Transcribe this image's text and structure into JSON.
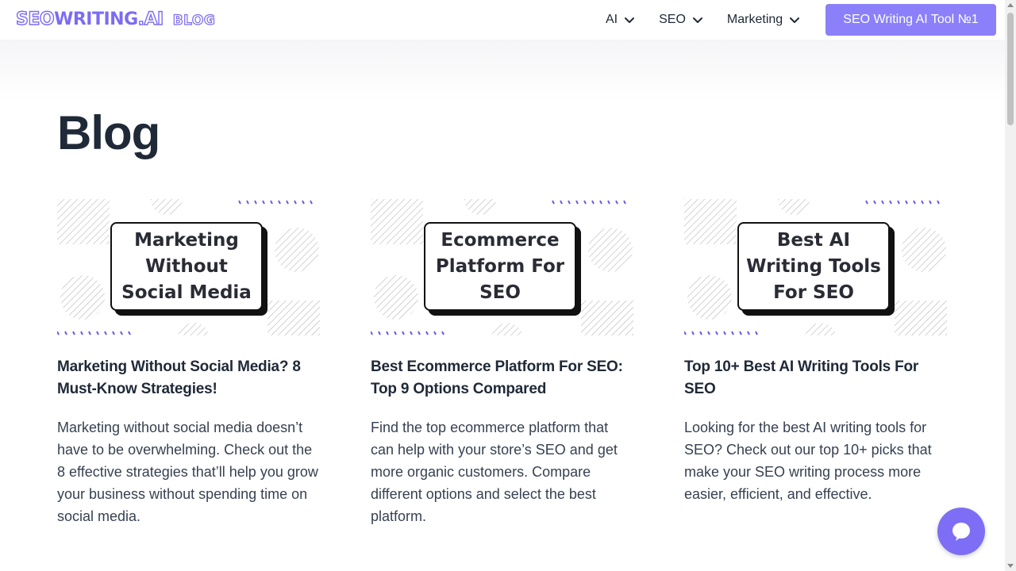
{
  "header": {
    "logo_seo": "SEO",
    "logo_writing": "WRITING",
    "logo_dot_ai": ".AI",
    "logo_blog": "BLOG",
    "nav": [
      {
        "label": "AI"
      },
      {
        "label": "SEO"
      },
      {
        "label": "Marketing"
      }
    ],
    "cta_label": "SEO Writing AI Tool №1"
  },
  "page": {
    "title": "Blog"
  },
  "cards": [
    {
      "thumb_text": "Marketing\nWithout\nSocial Media",
      "title": "Marketing Without Social Media? 8 Must-Know Strategies!",
      "description": "Marketing without social media doesn’t have to be overwhelming. Check out the 8 effective strategies that’ll help you grow your business without spending time on social media."
    },
    {
      "thumb_text": "Ecommerce\nPlatform For\nSEO",
      "title": "Best Ecommerce Platform For SEO: Top 9 Options Compared",
      "description": "Find the top ecommerce platform that can help with your store’s SEO and get more organic customers. Compare different options and select the best platform."
    },
    {
      "thumb_text": "Best AI\nWriting Tools\nFor SEO",
      "title": "Top 10+ Best AI Writing Tools For SEO",
      "description": "Looking for the best AI writing tools for SEO? Check out our top 10+ picks that make your SEO writing process more easier, efficient, and effective."
    }
  ],
  "colors": {
    "accent": "#8b80f9",
    "accent_dark": "#6c5ce7",
    "text": "#1f2937"
  },
  "icons": {
    "nav_chevron": "chevron-down-icon",
    "chat": "chat-bubble-icon"
  }
}
